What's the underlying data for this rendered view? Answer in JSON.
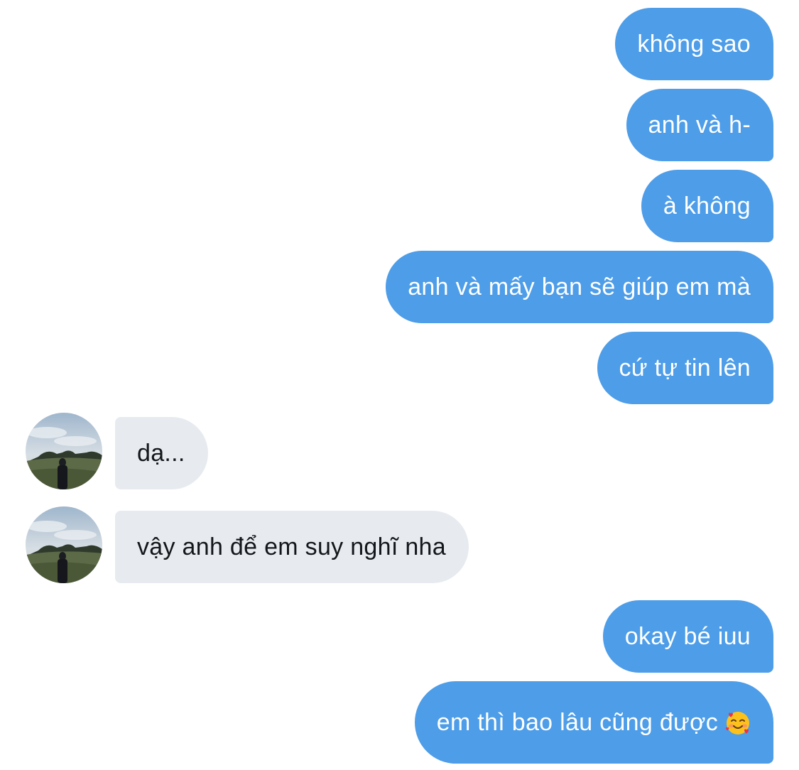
{
  "conversation": {
    "sent_color": "#4d9de8",
    "received_color": "#e7ebf0",
    "messages": [
      {
        "from": "me",
        "text": "không sao"
      },
      {
        "from": "me",
        "text": "anh và h-"
      },
      {
        "from": "me",
        "text": "à không"
      },
      {
        "from": "me",
        "text": "anh và mấy bạn sẽ giúp em mà"
      },
      {
        "from": "me",
        "text": "cứ tự tin lên"
      },
      {
        "from": "other",
        "text": "dạ..."
      },
      {
        "from": "other",
        "text": "vậy anh để em suy nghĩ nha"
      },
      {
        "from": "me",
        "text": "okay bé iuu"
      },
      {
        "from": "me",
        "text": "em thì bao lâu cũng được",
        "emoji": "smiling-face-with-hearts-icon"
      }
    ]
  }
}
